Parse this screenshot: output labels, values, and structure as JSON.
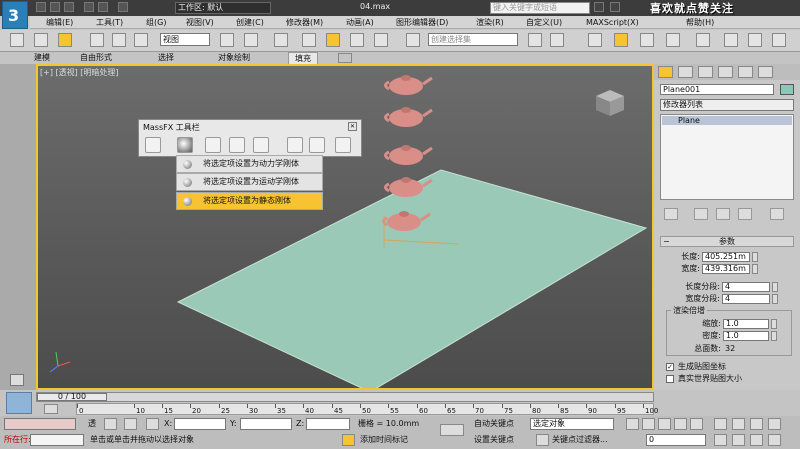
{
  "titlebar": {
    "workspace_label": "工作区: 默认",
    "filename": "04.max",
    "search_placeholder": "键入关键字或短语",
    "watermark": "喜欢就点赞关注"
  },
  "menubar": [
    "编辑(E)",
    "工具(T)",
    "组(G)",
    "视图(V)",
    "创建(C)",
    "修改器(M)",
    "动画(A)",
    "图形编辑器(D)",
    "渲染(R)",
    "自定义(U)",
    "MAXScript(X)",
    "帮助(H)"
  ],
  "toolbar": {
    "view_dropdown": "视图",
    "selection_set": "创建选择集"
  },
  "ribbon": {
    "tabs": [
      "建模",
      "自由形式",
      "选择",
      "对象绘制",
      "填充"
    ]
  },
  "viewport": {
    "label": "[+] [透视] [明暗处理]"
  },
  "massfx": {
    "title": "MassFX 工具栏",
    "menu_items": [
      {
        "label": "将选定项设置为动力学刚体",
        "highlighted": false
      },
      {
        "label": "将选定项设置为运动学刚体",
        "highlighted": false
      },
      {
        "label": "将选定项设置为静态刚体",
        "highlighted": true
      }
    ]
  },
  "command_panel": {
    "object_name": "Plane001",
    "object_color": "#8cc7b7",
    "modifier_list": "修改器列表",
    "stack_item": "Plane",
    "params_title": "参数",
    "length_label": "长度:",
    "length_value": "405.251m",
    "width_label": "宽度:",
    "width_value": "439.316m",
    "length_segs_label": "长度分段:",
    "length_segs_value": "4",
    "width_segs_label": "宽度分段:",
    "width_segs_value": "4",
    "render_mult_title": "渲染倍增",
    "scale_label": "缩放:",
    "scale_value": "1.0",
    "density_label": "密度:",
    "density_value": "1.0",
    "total_faces_label": "总面数:",
    "total_faces_value": "32",
    "gen_mapping_label": "生成贴图坐标",
    "gen_mapping_checked": true,
    "real_world_label": "真实世界贴图大小",
    "real_world_checked": false
  },
  "timeline": {
    "frame_display": "0 / 100",
    "ruler_ticks": [
      "0",
      "10",
      "15",
      "20",
      "25",
      "30",
      "35",
      "40",
      "45",
      "50",
      "55",
      "60",
      "65",
      "70",
      "75",
      "80",
      "85",
      "90",
      "95",
      "100"
    ]
  },
  "status": {
    "x_label": "X:",
    "y_label": "Y:",
    "z_label": "Z:",
    "grid_label": "栅格 = 10.0mm",
    "auto_key": "自动关键点",
    "set_key": "设置关键点",
    "selected_object": "选定对象",
    "key_filters": "关键点过滤器...",
    "prompt": "单击或单击并拖动以选择对象",
    "add_time_tag": "添加时间标记",
    "current_frame": "0",
    "mode_label": "所在行:",
    "welcome": "透"
  }
}
